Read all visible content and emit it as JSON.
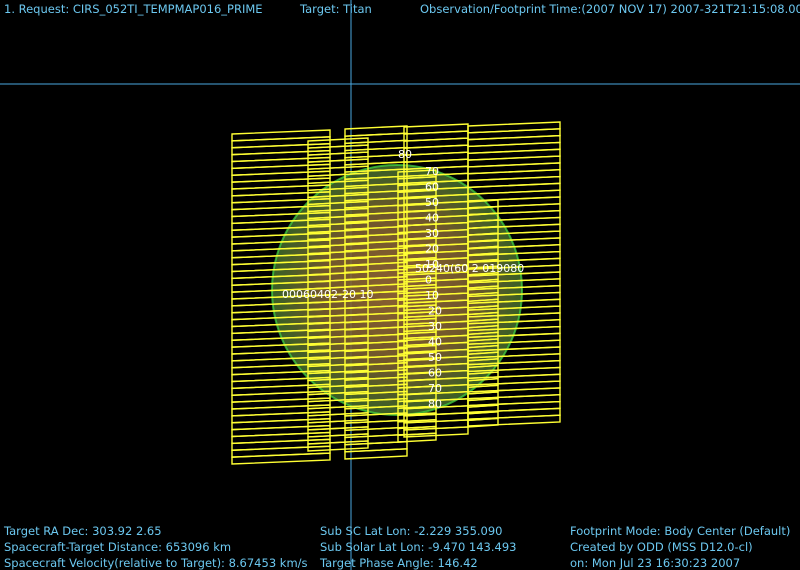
{
  "header": {
    "request": "1. Request: CIRS_052TI_TEMPMAP016_PRIME",
    "target": "Target: Titan",
    "obs_time": "Observation/Footprint Time:(2007 NOV 17) 2007-321T21:15:08.00"
  },
  "footer": {
    "ra_dec": "Target RA  Dec: 303.92    2.65",
    "distance": "Spacecraft-Target Distance:  653096 km",
    "velocity": "Spacecraft Velocity(relative to Target): 8.67453 km/s",
    "sub_sc": "Sub SC Lat Lon: -2.229  355.090",
    "sub_solar": "Sub Solar Lat Lon: -9.470  143.493",
    "phase": "Target Phase Angle: 146.42",
    "mode": "Footprint Mode: Body Center (Default)",
    "created": "Created by ODD (MSS D12.0-cl)",
    "on_date": "on: Mon Jul 23 16:30:23 2007"
  },
  "grid_labels": {
    "lon_row_left": "00060402-20 10",
    "lon_row_right": "50240(60 2 019080",
    "lat_top": "80",
    "lat_values": [
      "70",
      "60",
      "50",
      "40",
      "30",
      "20",
      "10",
      "0",
      "10",
      "20",
      "30",
      "40",
      "50",
      "60",
      "70",
      "80"
    ]
  },
  "colors": {
    "text": "#6cc8f0",
    "footprint": "#ffff33",
    "crosshair": "#4aa8e0",
    "disk": "#7a5a2e",
    "limb": "#44dd44"
  }
}
